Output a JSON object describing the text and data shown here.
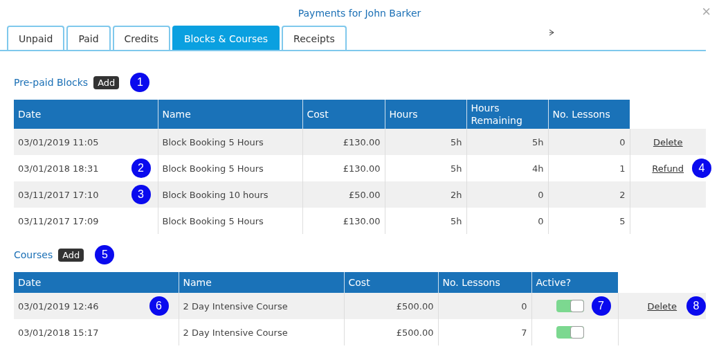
{
  "window": {
    "title": "Payments for John Barker",
    "close": "×"
  },
  "tabs": [
    {
      "label": "Unpaid",
      "selected": false
    },
    {
      "label": "Paid",
      "selected": false
    },
    {
      "label": "Credits",
      "selected": false
    },
    {
      "label": "Blocks & Courses",
      "selected": true
    },
    {
      "label": "Receipts",
      "selected": false
    }
  ],
  "blocks": {
    "title": "Pre-paid Blocks",
    "add_button": "Add",
    "callout": "1",
    "columns": [
      "Date",
      "Name",
      "Cost",
      "Hours",
      "Hours Remaining",
      "No. Lessons"
    ],
    "rows": [
      {
        "date": "03/01/2019 11:05",
        "name": "Block Booking 5 Hours",
        "cost": "£130.00",
        "hours": "5h",
        "remaining": "5h",
        "lessons": "0",
        "action": "Delete"
      },
      {
        "date": "03/01/2018 18:31",
        "name": "Block Booking 5 Hours",
        "cost": "£130.00",
        "hours": "5h",
        "remaining": "4h",
        "lessons": "1",
        "action": "Refund",
        "callout_date": "2",
        "callout_action": "4"
      },
      {
        "date": "03/11/2017 17:10",
        "name": "Block Booking 10 hours",
        "cost": "£50.00",
        "hours": "2h",
        "remaining": "0",
        "lessons": "2",
        "callout_date": "3"
      },
      {
        "date": "03/11/2017 17:09",
        "name": "Block Booking 5 Hours",
        "cost": "£130.00",
        "hours": "5h",
        "remaining": "0",
        "lessons": "5"
      }
    ]
  },
  "courses": {
    "title": "Courses",
    "add_button": "Add",
    "callout": "5",
    "columns": [
      "Date",
      "Name",
      "Cost",
      "No. Lessons",
      "Active?"
    ],
    "rows": [
      {
        "date": "03/01/2019 12:46",
        "name": "2 Day Intensive Course",
        "cost": "£500.00",
        "lessons": "0",
        "active": true,
        "action": "Delete",
        "callout_date": "6",
        "callout_active": "7",
        "callout_action": "8"
      },
      {
        "date": "03/01/2018 15:17",
        "name": "2 Day Intensive Course",
        "cost": "£500.00",
        "lessons": "7",
        "active": true
      }
    ]
  }
}
